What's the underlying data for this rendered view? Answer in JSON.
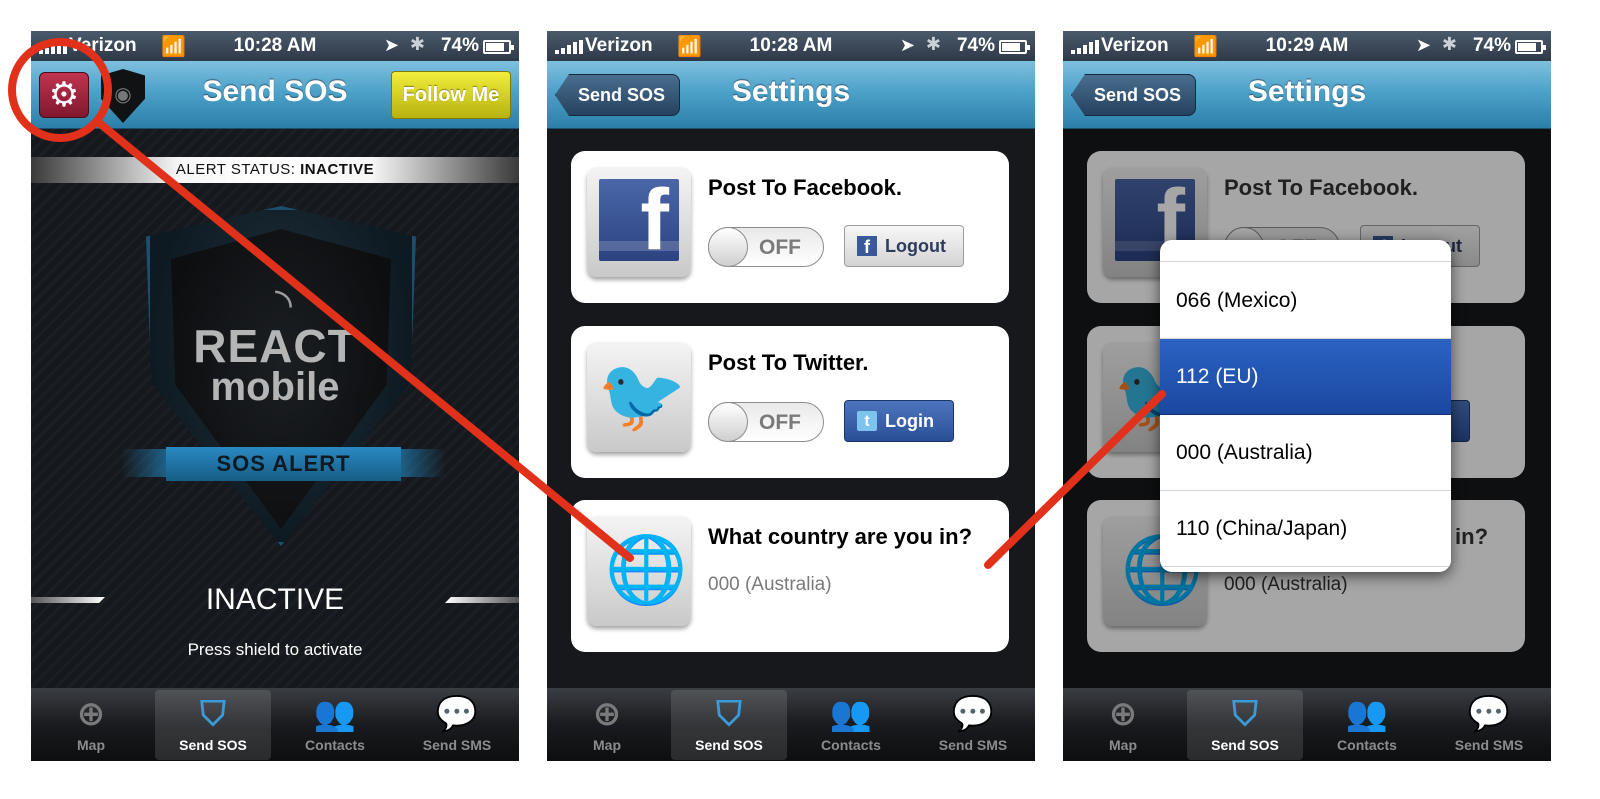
{
  "status_bar": {
    "carrier": "Verizon",
    "panels": [
      {
        "time": "10:28 AM",
        "battery": "74%"
      },
      {
        "time": "10:28 AM",
        "battery": "74%"
      },
      {
        "time": "10:29 AM",
        "battery": "74%"
      }
    ],
    "battery_level": 0.74
  },
  "screen1": {
    "title": "Send SOS",
    "follow_me_label": "Follow Me",
    "alert_status_label": "ALERT STATUS:",
    "alert_status_value": "INACTIVE",
    "logo_line1": "REACT",
    "logo_line2": "mobile",
    "sos_alert_label": "SOS ALERT",
    "status_big": "INACTIVE",
    "hint": "Press shield to activate"
  },
  "settings": {
    "back_label": "Send SOS",
    "title": "Settings",
    "facebook": {
      "title": "Post To Facebook.",
      "toggle": "OFF",
      "button": "Logout"
    },
    "twitter": {
      "title": "Post To Twitter.",
      "toggle": "OFF",
      "button": "Login"
    },
    "country": {
      "title": "What country are you in?",
      "value": "000 (Australia)"
    }
  },
  "picker": {
    "options": [
      "066 (Mexico)",
      "112 (EU)",
      "000 (Australia)",
      "110 (China/Japan)"
    ],
    "selected": "112 (EU)"
  },
  "tabbar": {
    "tabs": [
      "Map",
      "Send SOS",
      "Contacts",
      "Send SMS"
    ],
    "active": "Send SOS"
  },
  "colors": {
    "annotation": "#e1311b",
    "nav_blue": "#4da2ca",
    "picker_selected": "#2c62c3",
    "follow_me": "#d8d322"
  },
  "icons": [
    "settings-gear-icon",
    "wifi-icon",
    "location-arrow-icon",
    "bluetooth-icon",
    "battery-icon",
    "facebook-icon",
    "twitter-icon",
    "globe-icon",
    "map-crosshair-icon",
    "shield-icon",
    "contacts-icon",
    "sms-bubble-icon"
  ]
}
